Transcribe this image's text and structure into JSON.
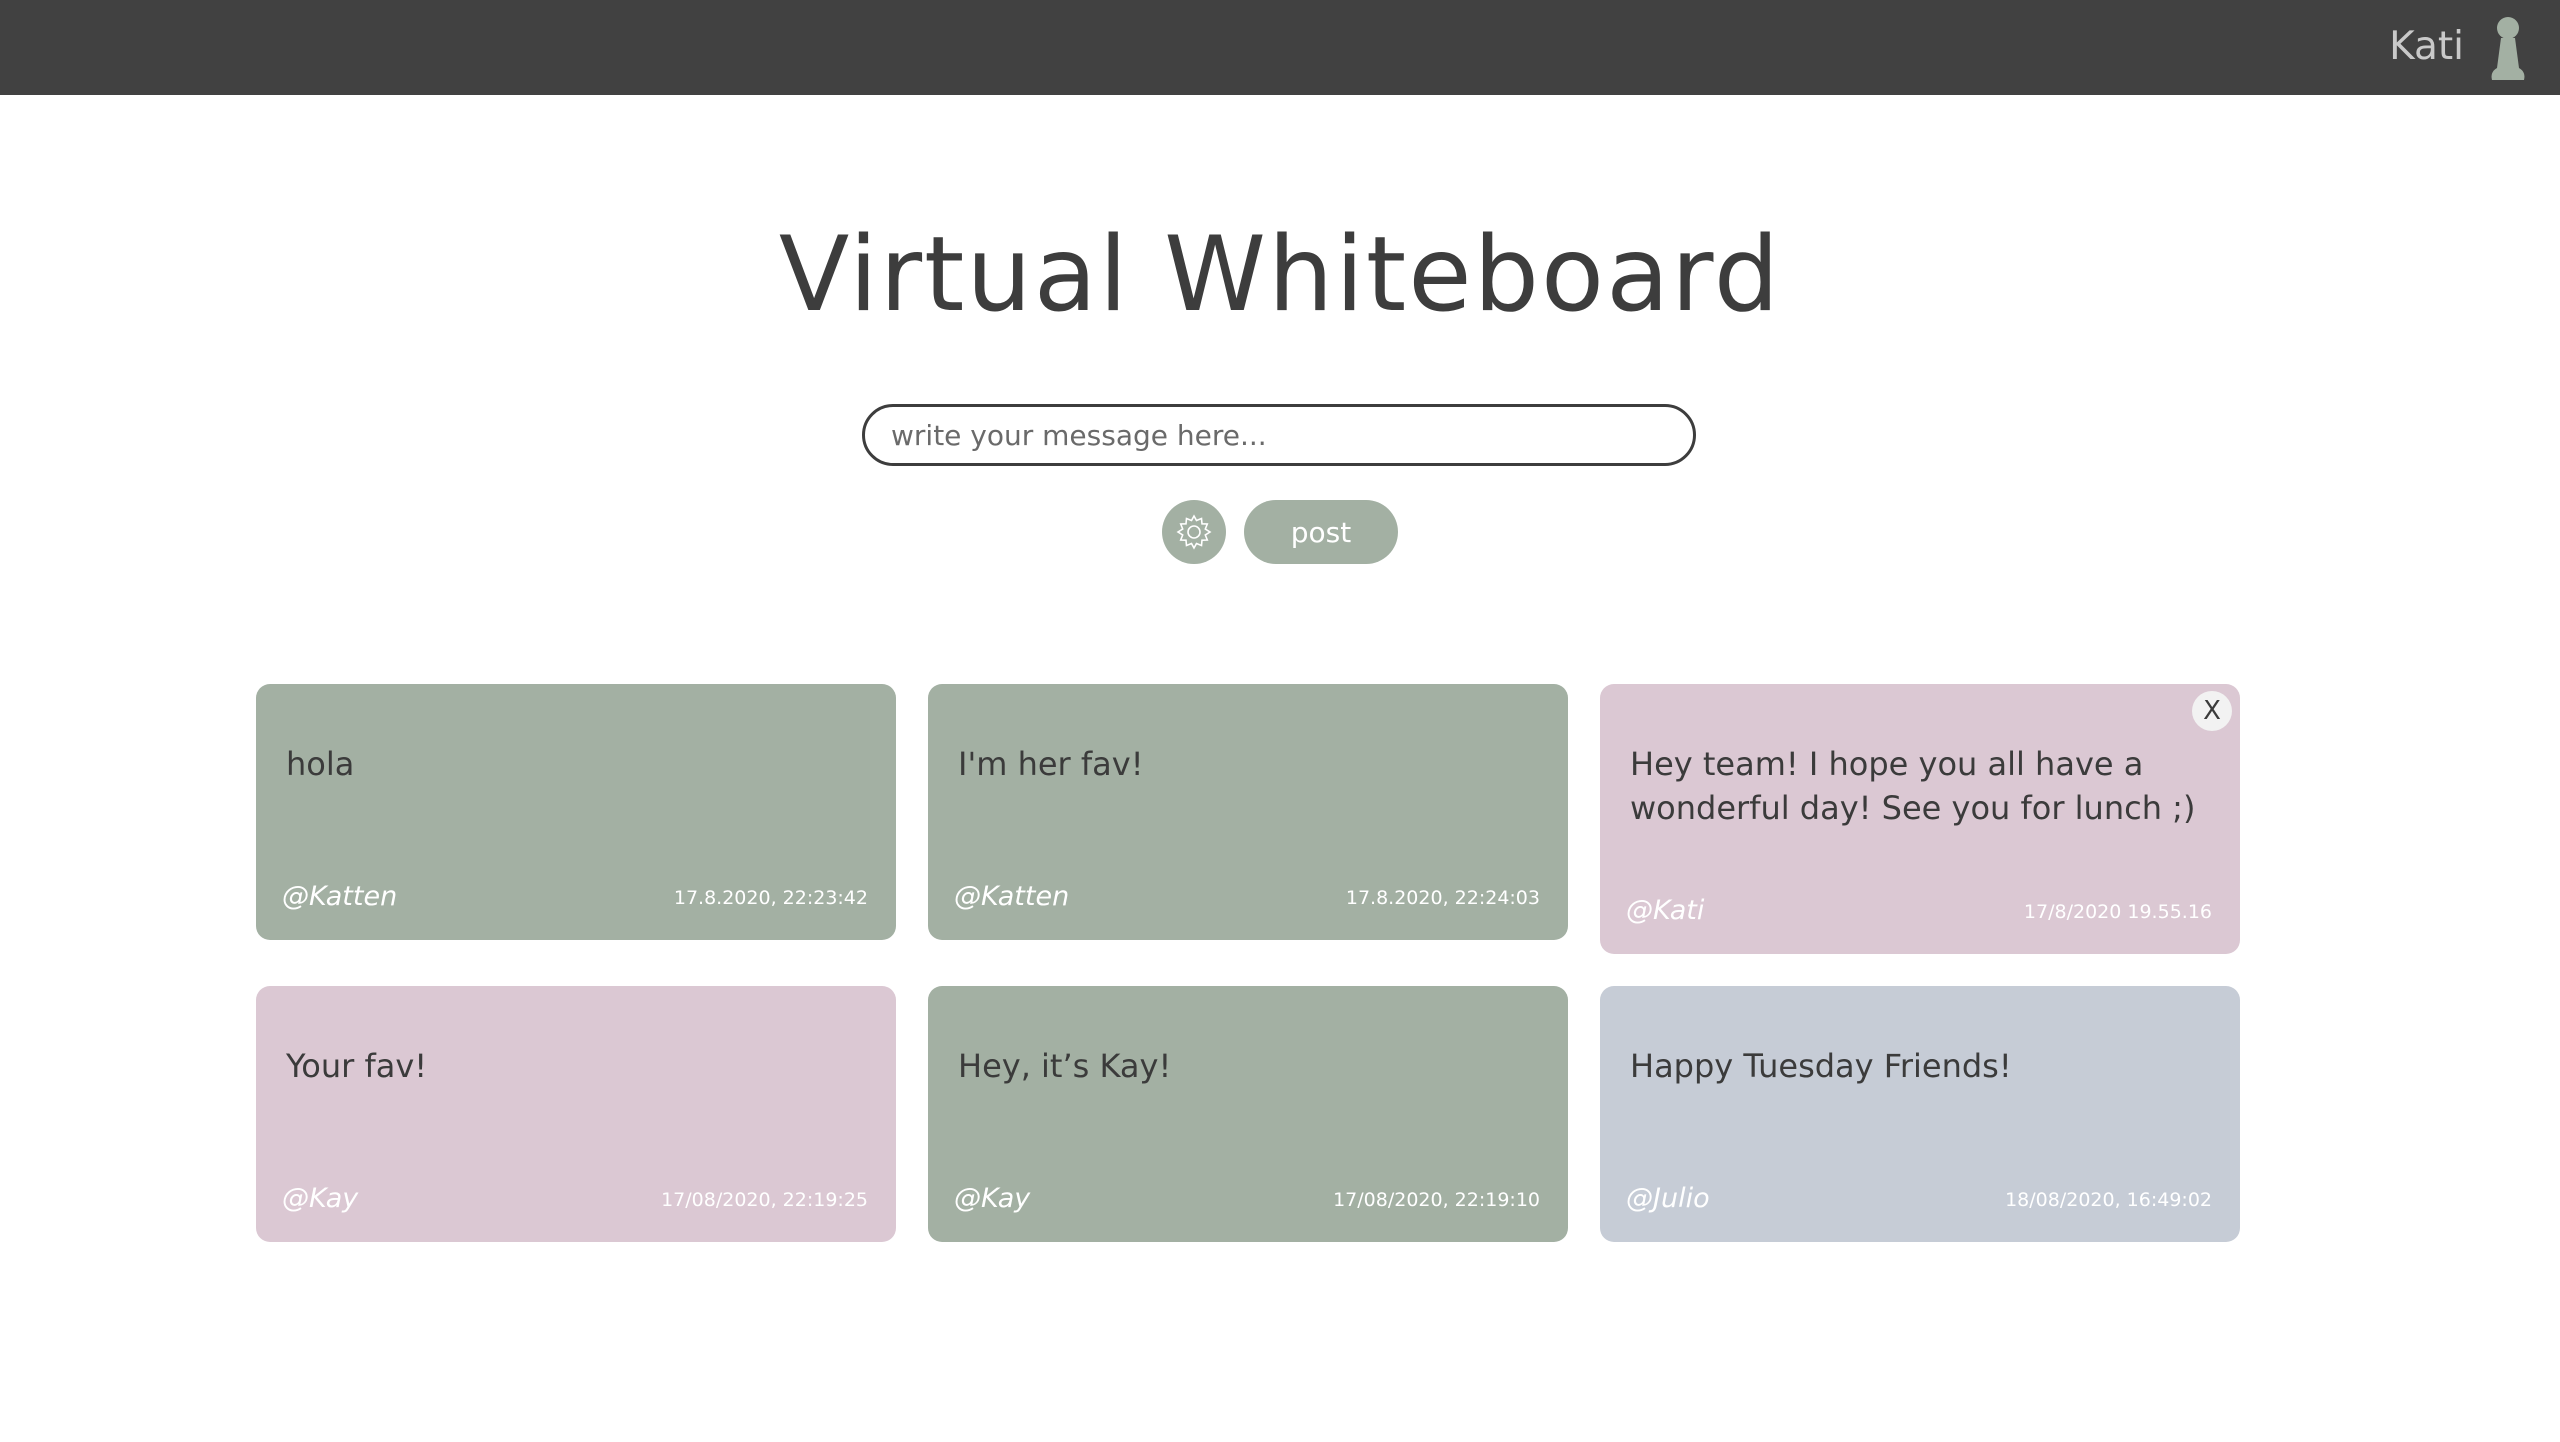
{
  "header": {
    "username": "Kati"
  },
  "main": {
    "title": "Virtual Whiteboard",
    "input_placeholder": "write your message here...",
    "post_label": "post"
  },
  "notes": [
    {
      "text": "hola",
      "author": "@Katten",
      "time": "17.8.2020, 22:23:42",
      "color": "#a3b0a3"
    },
    {
      "text": "I'm her fav!",
      "author": "@Katten",
      "time": "17.8.2020, 22:24:03",
      "color": "#a3b0a3"
    },
    {
      "text": "Hey team! I hope you all have a wonderful day! See you for lunch ;)",
      "author": "@Kati",
      "time": "17/8/2020 19.55.16",
      "color": "#dbc8d3",
      "close_label": "X"
    },
    {
      "text": "Your fav!",
      "author": "@Kay",
      "time": "17/08/2020, 22:19:25",
      "color": "#dbc8d3"
    },
    {
      "text": "Hey, it’s Kay!",
      "author": "@Kay",
      "time": "17/08/2020, 22:19:10",
      "color": "#a3b0a3"
    },
    {
      "text": "Happy Tuesday Friends!",
      "author": "@Julio",
      "time": "18/08/2020, 16:49:02",
      "color": "#c6ccd6"
    }
  ],
  "colors": {
    "topbar": "#414141",
    "accent_green": "#a3b0a3",
    "accent_pink": "#dbc8d3",
    "accent_blue": "#c6ccd6"
  },
  "icons": {
    "settings": "gear-icon",
    "avatar": "pawn-avatar-icon",
    "close": "close-icon"
  }
}
